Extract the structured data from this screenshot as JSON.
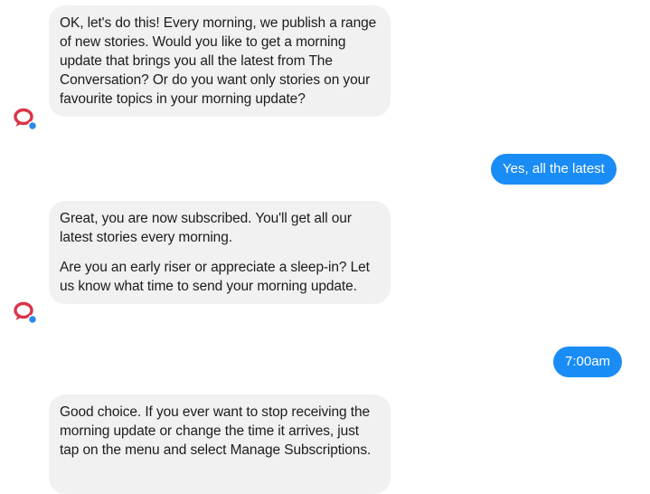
{
  "conversation": {
    "messages": [
      {
        "sender": "bot",
        "paragraphs": [
          "OK, let's do this! Every morning, we publish a range of new stories. Would you like to get a morning update that brings you all the latest from The Conversation?  Or do you want only stories on your favourite topics in your morning update?"
        ]
      },
      {
        "sender": "user",
        "text": "Yes, all the latest"
      },
      {
        "sender": "bot",
        "paragraphs": [
          "Great, you are now subscribed. You'll get all our latest stories every morning.",
          "Are you an early riser or appreciate a sleep-in? Let us know what time to send your morning update."
        ]
      },
      {
        "sender": "user",
        "text": "7:00am"
      },
      {
        "sender": "bot",
        "paragraphs": [
          "Good choice. If you ever want to stop receiving the morning update or change the time it arrives, just tap on the menu and select Manage Subscriptions."
        ]
      }
    ]
  },
  "colors": {
    "bot_bubble": "#f1f1f1",
    "user_bubble": "#1a8cf5",
    "avatar_red": "#d8354a",
    "avatar_status": "#2f8ae5"
  },
  "icons": {
    "bot_avatar": "speech-bubble-icon"
  }
}
